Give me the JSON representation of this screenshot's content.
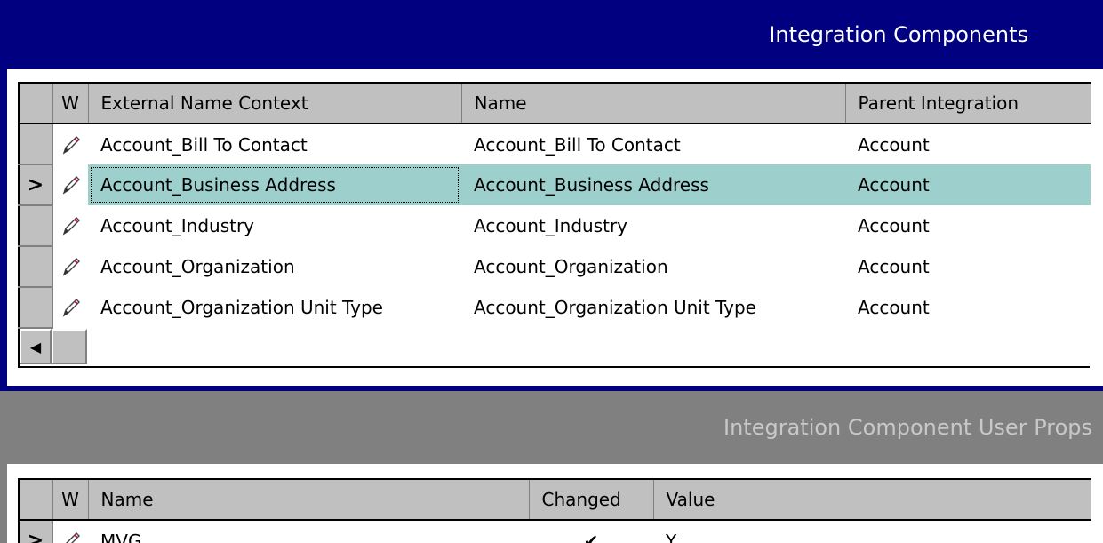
{
  "integration_components": {
    "title": "Integration Components",
    "columns": [
      "W",
      "External Name Context",
      "Name",
      "Parent Integration"
    ],
    "rows": [
      {
        "selector": "",
        "external_name_context": "Account_Bill To Contact",
        "name": "Account_Bill To Contact",
        "parent": "Account"
      },
      {
        "selector": ">",
        "external_name_context": "Account_Business Address",
        "name": "Account_Business Address",
        "parent": "Account"
      },
      {
        "selector": "",
        "external_name_context": "Account_Industry",
        "name": "Account_Industry",
        "parent": "Account"
      },
      {
        "selector": "",
        "external_name_context": "Account_Organization",
        "name": "Account_Organization",
        "parent": "Account"
      },
      {
        "selector": "",
        "external_name_context": "Account_Organization Unit Type",
        "name": "Account_Organization Unit Type",
        "parent": "Account"
      }
    ],
    "scroll_left_arrow": "◀"
  },
  "user_props": {
    "title": "Integration Component User Props",
    "columns": [
      "W",
      "Name",
      "Changed",
      "Value"
    ],
    "rows": [
      {
        "selector": ">",
        "name": "MVG",
        "changed": "✔",
        "value": "Y"
      }
    ]
  },
  "colors": {
    "active_title_bar": "#000080",
    "inactive_title_bar": "#808080",
    "selected_row": "#9dcfcd"
  },
  "icons": {
    "write_indicator": "pencil-icon"
  }
}
